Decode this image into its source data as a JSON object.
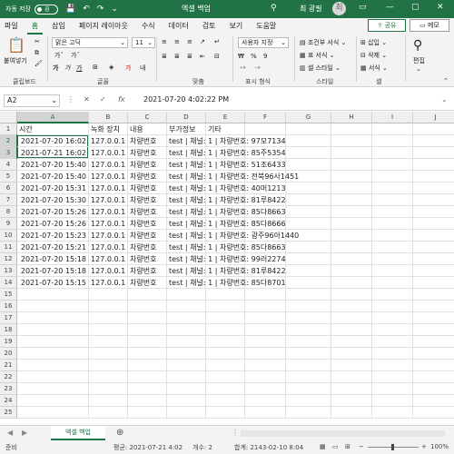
{
  "titlebar": {
    "autosave_label": "자동 저장",
    "autosave_state": "끔",
    "doc_title": "엑셀 백업",
    "user_name": "최 광필",
    "user_initial": "최"
  },
  "menu": {
    "tabs": [
      "파일",
      "홈",
      "삽입",
      "페이지 레이아웃",
      "수식",
      "데이터",
      "검토",
      "보기",
      "도움말"
    ],
    "share": "공유",
    "memo": "메모"
  },
  "ribbon": {
    "paste": "붙여넣기",
    "clipboard_label": "클립보드",
    "font_name": "맑은 고딕",
    "font_size": "11",
    "font_label": "글꼴",
    "align_label": "맞춤",
    "number_format": "사용자 지정",
    "number_label": "표시 형식",
    "conditional": "조건부 서식",
    "table_format": "표 서식",
    "cell_style": "셀 스타일",
    "style_label": "스타일",
    "insert": "삽입",
    "delete": "삭제",
    "format": "서식",
    "cells_label": "셀",
    "edit": "편집"
  },
  "formula": {
    "namebox": "A2",
    "value": "2021-07-20  4:02:22 PM"
  },
  "grid": {
    "columns": [
      "A",
      "B",
      "C",
      "D",
      "E",
      "F",
      "G",
      "H",
      "I",
      "J"
    ],
    "headers": [
      "시간",
      "녹화 장치",
      "내용",
      "부가정보",
      "기타"
    ],
    "rows": [
      [
        "2021-07-20 16:02",
        "127.0.0.1",
        "차량번호",
        "test | 채널: 1 | 차량번호: 97모7134"
      ],
      [
        "2021-07-21 16:02",
        "127.0.0.1",
        "차량번호",
        "test | 채널: 1 | 차량번호: 85주5354"
      ],
      [
        "2021-07-20 15:40",
        "127.0.0.1",
        "차량번호",
        "test | 채널: 1 | 차량번호: 51조6433"
      ],
      [
        "2021-07-20 15:40",
        "127.0.0.1",
        "차량번호",
        "test | 채널: 1 | 차량번호: 전북96사1451"
      ],
      [
        "2021-07-20 15:31",
        "127.0.0.1",
        "차량번호",
        "test | 채널: 1 | 차량번호: 40머1213"
      ],
      [
        "2021-07-20 15:30",
        "127.0.0.1",
        "차량번호",
        "test | 채널: 1 | 차량번호: 81루8422"
      ],
      [
        "2021-07-20 15:26",
        "127.0.0.1",
        "차량번호",
        "test | 채널: 1 | 차량번호: 85다8663"
      ],
      [
        "2021-07-20 15:26",
        "127.0.0.1",
        "차량번호",
        "test | 채널: 1 | 차량번호: 85다8666"
      ],
      [
        "2021-07-20 15:23",
        "127.0.0.1",
        "차량번호",
        "test | 채널: 1 | 차량번호: 광주96아1440"
      ],
      [
        "2021-07-20 15:21",
        "127.0.0.1",
        "차량번호",
        "test | 채널: 1 | 차량번호: 85다8663"
      ],
      [
        "2021-07-20 15:18",
        "127.0.0.1",
        "차량번호",
        "test | 채널: 1 | 차량번호: 99러2274"
      ],
      [
        "2021-07-20 15:18",
        "127.0.0.1",
        "차량번호",
        "test | 채널: 1 | 차량번호: 81루8422"
      ],
      [
        "2021-07-20 15:15",
        "127.0.0.1",
        "차량번호",
        "test | 채널: 1 | 차량번호: 85다8701"
      ]
    ],
    "row_count": 25
  },
  "sheets": {
    "active": "엑셀 백업"
  },
  "status": {
    "mode": "준비",
    "average": "평균: 2021-07-21 4:02",
    "count": "개수: 2",
    "sum": "합계: 2143-02-10 8:04",
    "zoom": "100%"
  },
  "colors": {
    "accent": "#217346"
  }
}
